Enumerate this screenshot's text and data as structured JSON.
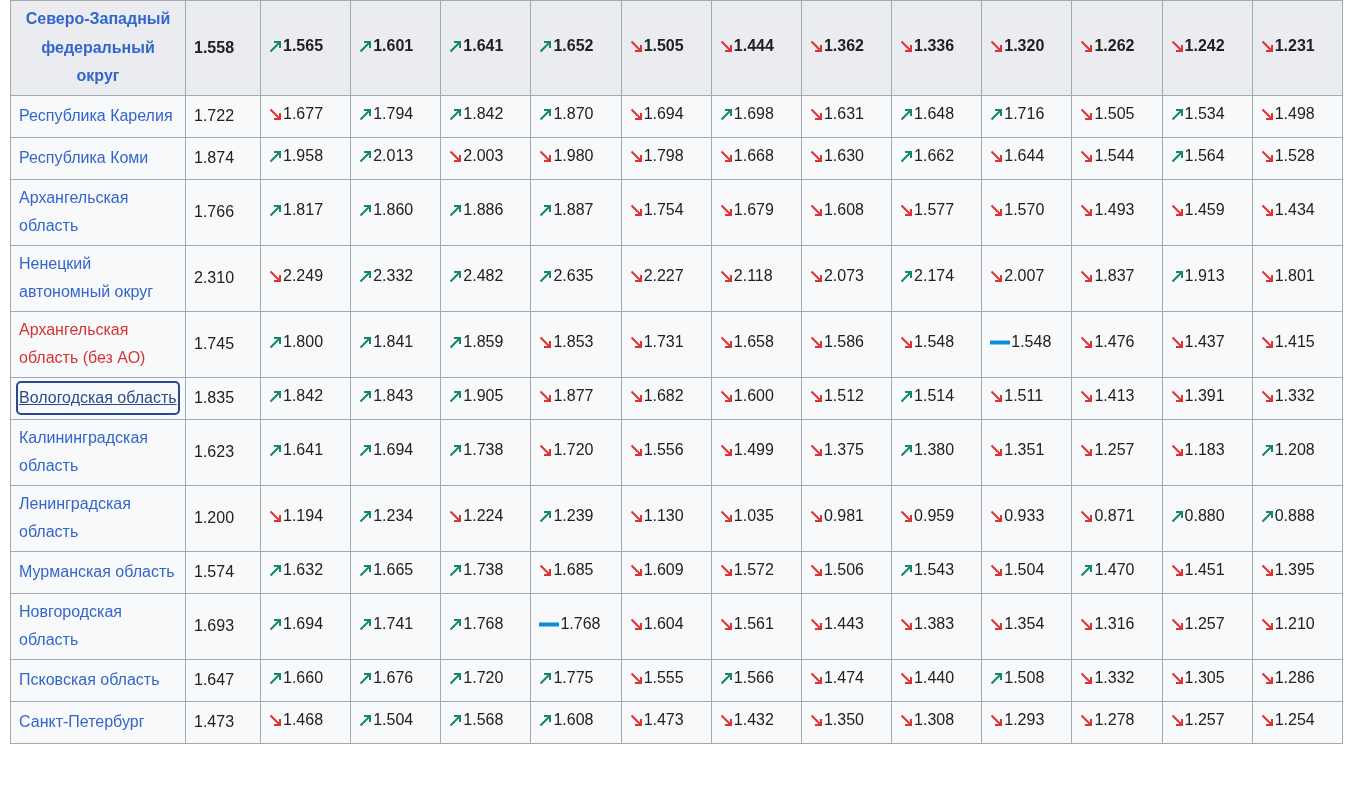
{
  "header": {
    "district": "Северо-Западный федеральный округ",
    "base": "1.558",
    "cells": [
      {
        "kind": "up",
        "value": "1.565"
      },
      {
        "kind": "up",
        "value": "1.601"
      },
      {
        "kind": "up",
        "value": "1.641"
      },
      {
        "kind": "up",
        "value": "1.652"
      },
      {
        "kind": "down",
        "value": "1.505"
      },
      {
        "kind": "down",
        "value": "1.444"
      },
      {
        "kind": "down",
        "value": "1.362"
      },
      {
        "kind": "down",
        "value": "1.336"
      },
      {
        "kind": "down",
        "value": "1.320"
      },
      {
        "kind": "down",
        "value": "1.262"
      },
      {
        "kind": "down",
        "value": "1.242"
      },
      {
        "kind": "down",
        "value": "1.231"
      }
    ]
  },
  "rows": [
    {
      "name": "Республика Карелия",
      "missing": false,
      "focused": false,
      "base": "1.722",
      "cells": [
        {
          "kind": "down",
          "value": "1.677"
        },
        {
          "kind": "up",
          "value": "1.794"
        },
        {
          "kind": "up",
          "value": "1.842"
        },
        {
          "kind": "up",
          "value": "1.870"
        },
        {
          "kind": "down",
          "value": "1.694"
        },
        {
          "kind": "up",
          "value": "1.698"
        },
        {
          "kind": "down",
          "value": "1.631"
        },
        {
          "kind": "up",
          "value": "1.648"
        },
        {
          "kind": "up",
          "value": "1.716"
        },
        {
          "kind": "down",
          "value": "1.505"
        },
        {
          "kind": "up",
          "value": "1.534"
        },
        {
          "kind": "down",
          "value": "1.498"
        }
      ]
    },
    {
      "name": "Республика Коми",
      "missing": false,
      "focused": false,
      "base": "1.874",
      "cells": [
        {
          "kind": "up",
          "value": "1.958"
        },
        {
          "kind": "up",
          "value": "2.013"
        },
        {
          "kind": "down",
          "value": "2.003"
        },
        {
          "kind": "down",
          "value": "1.980"
        },
        {
          "kind": "down",
          "value": "1.798"
        },
        {
          "kind": "down",
          "value": "1.668"
        },
        {
          "kind": "down",
          "value": "1.630"
        },
        {
          "kind": "up",
          "value": "1.662"
        },
        {
          "kind": "down",
          "value": "1.644"
        },
        {
          "kind": "down",
          "value": "1.544"
        },
        {
          "kind": "up",
          "value": "1.564"
        },
        {
          "kind": "down",
          "value": "1.528"
        }
      ]
    },
    {
      "name": "Архангельская область",
      "missing": false,
      "focused": false,
      "base": "1.766",
      "cells": [
        {
          "kind": "up",
          "value": "1.817"
        },
        {
          "kind": "up",
          "value": "1.860"
        },
        {
          "kind": "up",
          "value": "1.886"
        },
        {
          "kind": "up",
          "value": "1.887"
        },
        {
          "kind": "down",
          "value": "1.754"
        },
        {
          "kind": "down",
          "value": "1.679"
        },
        {
          "kind": "down",
          "value": "1.608"
        },
        {
          "kind": "down",
          "value": "1.577"
        },
        {
          "kind": "down",
          "value": "1.570"
        },
        {
          "kind": "down",
          "value": "1.493"
        },
        {
          "kind": "down",
          "value": "1.459"
        },
        {
          "kind": "down",
          "value": "1.434"
        }
      ]
    },
    {
      "name": "Ненецкий автономный округ",
      "missing": false,
      "focused": false,
      "base": "2.310",
      "cells": [
        {
          "kind": "down",
          "value": "2.249"
        },
        {
          "kind": "up",
          "value": "2.332"
        },
        {
          "kind": "up",
          "value": "2.482"
        },
        {
          "kind": "up",
          "value": "2.635"
        },
        {
          "kind": "down",
          "value": "2.227"
        },
        {
          "kind": "down",
          "value": "2.118"
        },
        {
          "kind": "down",
          "value": "2.073"
        },
        {
          "kind": "up",
          "value": "2.174"
        },
        {
          "kind": "down",
          "value": "2.007"
        },
        {
          "kind": "down",
          "value": "1.837"
        },
        {
          "kind": "up",
          "value": "1.913"
        },
        {
          "kind": "down",
          "value": "1.801"
        }
      ]
    },
    {
      "name": "Архангельская область (без АО)",
      "missing": true,
      "focused": false,
      "base": "1.745",
      "cells": [
        {
          "kind": "up",
          "value": "1.800"
        },
        {
          "kind": "up",
          "value": "1.841"
        },
        {
          "kind": "up",
          "value": "1.859"
        },
        {
          "kind": "down",
          "value": "1.853"
        },
        {
          "kind": "down",
          "value": "1.731"
        },
        {
          "kind": "down",
          "value": "1.658"
        },
        {
          "kind": "down",
          "value": "1.586"
        },
        {
          "kind": "down",
          "value": "1.548"
        },
        {
          "kind": "flat",
          "value": "1.548"
        },
        {
          "kind": "down",
          "value": "1.476"
        },
        {
          "kind": "down",
          "value": "1.437"
        },
        {
          "kind": "down",
          "value": "1.415"
        }
      ]
    },
    {
      "name": "Вологодская область",
      "missing": false,
      "focused": true,
      "base": "1.835",
      "cells": [
        {
          "kind": "up",
          "value": "1.842"
        },
        {
          "kind": "up",
          "value": "1.843"
        },
        {
          "kind": "up",
          "value": "1.905"
        },
        {
          "kind": "down",
          "value": "1.877"
        },
        {
          "kind": "down",
          "value": "1.682"
        },
        {
          "kind": "down",
          "value": "1.600"
        },
        {
          "kind": "down",
          "value": "1.512"
        },
        {
          "kind": "up",
          "value": "1.514"
        },
        {
          "kind": "down",
          "value": "1.511"
        },
        {
          "kind": "down",
          "value": "1.413"
        },
        {
          "kind": "down",
          "value": "1.391"
        },
        {
          "kind": "down",
          "value": "1.332"
        }
      ]
    },
    {
      "name": "Калининградская область",
      "missing": false,
      "focused": false,
      "base": "1.623",
      "cells": [
        {
          "kind": "up",
          "value": "1.641"
        },
        {
          "kind": "up",
          "value": "1.694"
        },
        {
          "kind": "up",
          "value": "1.738"
        },
        {
          "kind": "down",
          "value": "1.720"
        },
        {
          "kind": "down",
          "value": "1.556"
        },
        {
          "kind": "down",
          "value": "1.499"
        },
        {
          "kind": "down",
          "value": "1.375"
        },
        {
          "kind": "up",
          "value": "1.380"
        },
        {
          "kind": "down",
          "value": "1.351"
        },
        {
          "kind": "down",
          "value": "1.257"
        },
        {
          "kind": "down",
          "value": "1.183"
        },
        {
          "kind": "up",
          "value": "1.208"
        }
      ]
    },
    {
      "name": "Ленинградская область",
      "missing": false,
      "focused": false,
      "base": "1.200",
      "cells": [
        {
          "kind": "down",
          "value": "1.194"
        },
        {
          "kind": "up",
          "value": "1.234"
        },
        {
          "kind": "down",
          "value": "1.224"
        },
        {
          "kind": "up",
          "value": "1.239"
        },
        {
          "kind": "down",
          "value": "1.130"
        },
        {
          "kind": "down",
          "value": "1.035"
        },
        {
          "kind": "down",
          "value": "0.981"
        },
        {
          "kind": "down",
          "value": "0.959"
        },
        {
          "kind": "down",
          "value": "0.933"
        },
        {
          "kind": "down",
          "value": "0.871"
        },
        {
          "kind": "up",
          "value": "0.880"
        },
        {
          "kind": "up",
          "value": "0.888"
        }
      ]
    },
    {
      "name": "Мурманская область",
      "missing": false,
      "focused": false,
      "base": "1.574",
      "cells": [
        {
          "kind": "up",
          "value": "1.632"
        },
        {
          "kind": "up",
          "value": "1.665"
        },
        {
          "kind": "up",
          "value": "1.738"
        },
        {
          "kind": "down",
          "value": "1.685"
        },
        {
          "kind": "down",
          "value": "1.609"
        },
        {
          "kind": "down",
          "value": "1.572"
        },
        {
          "kind": "down",
          "value": "1.506"
        },
        {
          "kind": "up",
          "value": "1.543"
        },
        {
          "kind": "down",
          "value": "1.504"
        },
        {
          "kind": "up",
          "value": "1.470"
        },
        {
          "kind": "down",
          "value": "1.451"
        },
        {
          "kind": "down",
          "value": "1.395"
        }
      ]
    },
    {
      "name": "Новгородская область",
      "missing": false,
      "focused": false,
      "base": "1.693",
      "cells": [
        {
          "kind": "up",
          "value": "1.694"
        },
        {
          "kind": "up",
          "value": "1.741"
        },
        {
          "kind": "up",
          "value": "1.768"
        },
        {
          "kind": "flat",
          "value": "1.768"
        },
        {
          "kind": "down",
          "value": "1.604"
        },
        {
          "kind": "down",
          "value": "1.561"
        },
        {
          "kind": "down",
          "value": "1.443"
        },
        {
          "kind": "down",
          "value": "1.383"
        },
        {
          "kind": "down",
          "value": "1.354"
        },
        {
          "kind": "down",
          "value": "1.316"
        },
        {
          "kind": "down",
          "value": "1.257"
        },
        {
          "kind": "down",
          "value": "1.210"
        }
      ]
    },
    {
      "name": "Псковская область",
      "missing": false,
      "focused": false,
      "base": "1.647",
      "cells": [
        {
          "kind": "up",
          "value": "1.660"
        },
        {
          "kind": "up",
          "value": "1.676"
        },
        {
          "kind": "up",
          "value": "1.720"
        },
        {
          "kind": "up",
          "value": "1.775"
        },
        {
          "kind": "down",
          "value": "1.555"
        },
        {
          "kind": "up",
          "value": "1.566"
        },
        {
          "kind": "down",
          "value": "1.474"
        },
        {
          "kind": "down",
          "value": "1.440"
        },
        {
          "kind": "up",
          "value": "1.508"
        },
        {
          "kind": "down",
          "value": "1.332"
        },
        {
          "kind": "down",
          "value": "1.305"
        },
        {
          "kind": "down",
          "value": "1.286"
        }
      ]
    },
    {
      "name": "Санкт-Петербург",
      "missing": false,
      "focused": false,
      "base": "1.473",
      "cells": [
        {
          "kind": "down",
          "value": "1.468"
        },
        {
          "kind": "up",
          "value": "1.504"
        },
        {
          "kind": "up",
          "value": "1.568"
        },
        {
          "kind": "up",
          "value": "1.608"
        },
        {
          "kind": "down",
          "value": "1.473"
        },
        {
          "kind": "down",
          "value": "1.432"
        },
        {
          "kind": "down",
          "value": "1.350"
        },
        {
          "kind": "down",
          "value": "1.308"
        },
        {
          "kind": "down",
          "value": "1.293"
        },
        {
          "kind": "down",
          "value": "1.278"
        },
        {
          "kind": "down",
          "value": "1.257"
        },
        {
          "kind": "down",
          "value": "1.254"
        }
      ]
    }
  ]
}
